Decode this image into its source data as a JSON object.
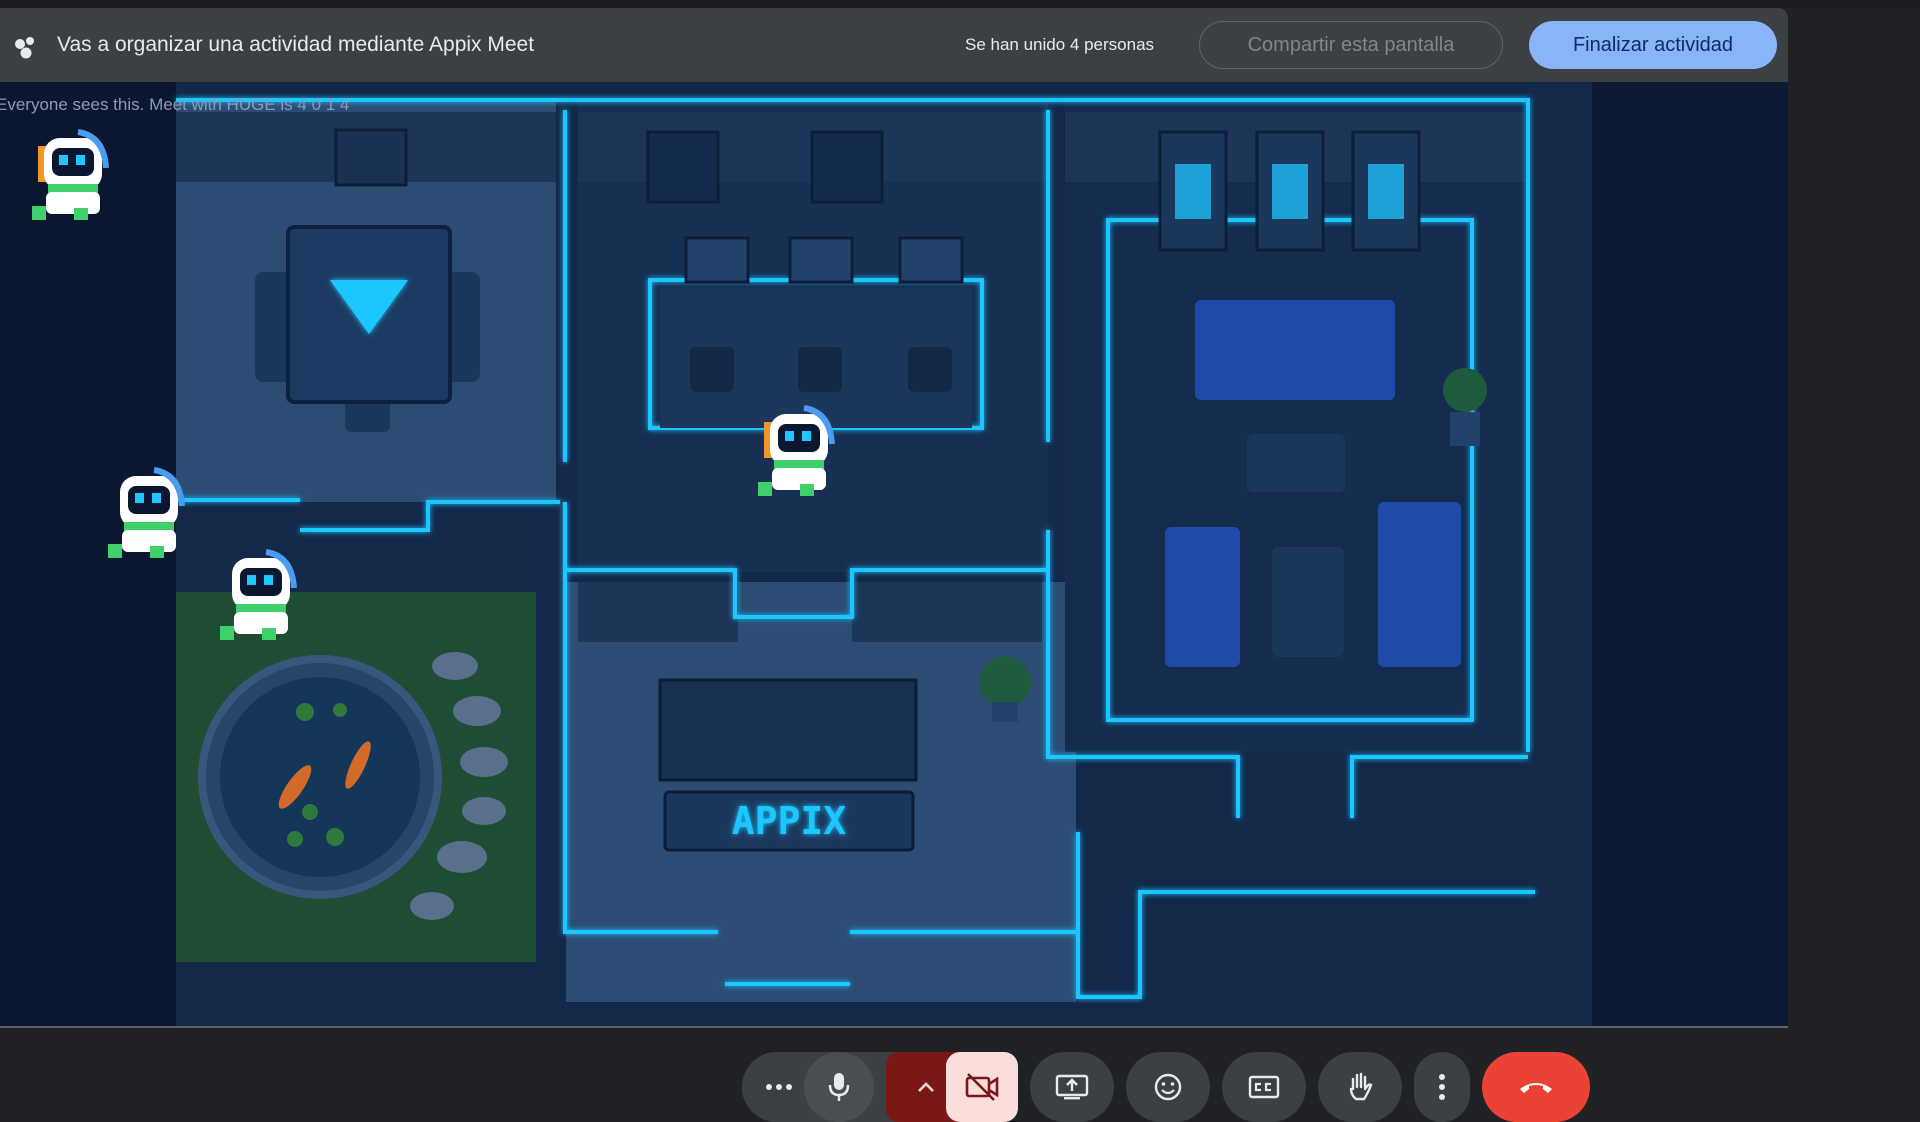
{
  "banner": {
    "title": "Vas a organizar una actividad mediante Appix Meet",
    "joined": "Se han unido 4 personas",
    "share_label": "Compartir esta pantalla",
    "end_label": "Finalizar actividad"
  },
  "stage": {
    "overlay_text": "Everyone sees this. Meet with HUGE is 4 0 1 4",
    "sign_text": "APPIX"
  },
  "controls": {
    "more_options_icon": "more-horiz-icon",
    "mic_icon": "mic-icon",
    "camera_icon": "camera-off-icon",
    "present_icon": "present-screen-icon",
    "reactions_icon": "emoji-icon",
    "captions_icon": "closed-captions-icon",
    "raise_hand_icon": "hand-icon",
    "menu_icon": "more-vert-icon",
    "leave_icon": "call-end-icon"
  },
  "colors": {
    "banner_bg": "#3c4043",
    "accent_blue": "#8ab4f8",
    "neon": "#1fc6ff",
    "camera_off_red": "#7a1818",
    "leave_red": "#ea4335"
  }
}
